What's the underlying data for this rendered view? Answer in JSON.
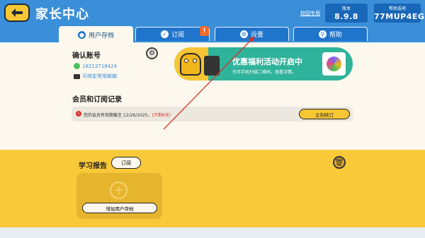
{
  "header": {
    "title": "家长中心",
    "campus_link": "校园专用",
    "version_label": "版本",
    "version_value": "8.9.8",
    "help_label": "帮助选项",
    "help_value": "77MUP4EG"
  },
  "tabs": [
    {
      "label": "用户存档",
      "icon": "user-icon"
    },
    {
      "label": "订阅",
      "icon": "check-icon"
    },
    {
      "label": "设置",
      "icon": "settings-icon"
    },
    {
      "label": "帮助",
      "icon": "search-icon"
    }
  ],
  "subscribe_badge": "!",
  "account": {
    "title": "确认账号",
    "phone": "18213718424",
    "email_hint": "可绑定常用邮箱"
  },
  "promo": {
    "title": "优惠福利活动开启中",
    "subtitle": "也可手机扫描二维码，查看详情。"
  },
  "subscription": {
    "title": "会员和订阅记录",
    "text": "您的会员有效期截至 12/26/2025，",
    "remaining": "(只剩6天)",
    "renew_button": "立刻续订"
  },
  "report": {
    "title": "学习报告",
    "subscribe_button": "订阅",
    "add_button": "增加用户存档"
  },
  "colors": {
    "header_blue": "#3a8fd8",
    "accent_yellow": "#f9c93a",
    "promo_green": "#2fb39a"
  }
}
